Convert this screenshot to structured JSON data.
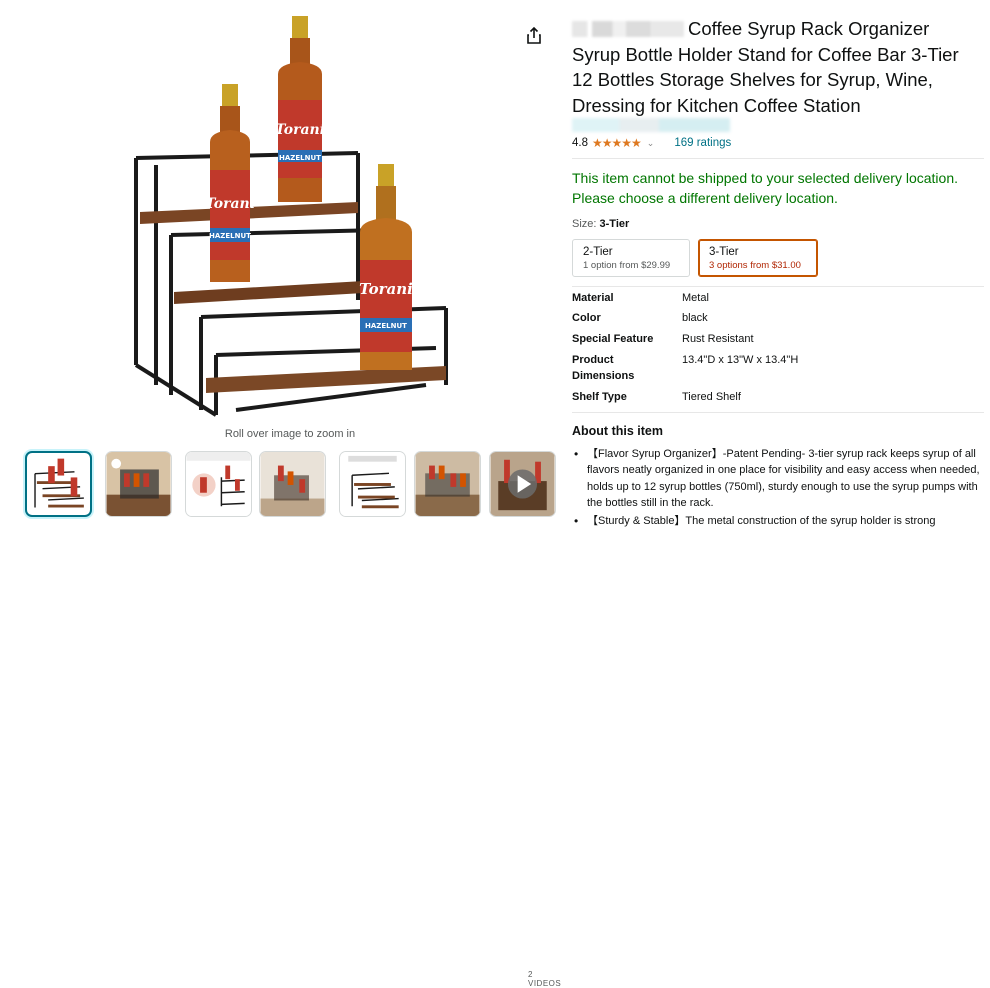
{
  "gallery": {
    "zoom_hint": "Roll over image to zoom in",
    "videos_label": "2 VIDEOS",
    "share_icon": "share-icon",
    "thumbnails": [
      {
        "name": "thumb-main-rack",
        "active": true
      },
      {
        "name": "thumb-kitchen-scene",
        "active": false
      },
      {
        "name": "thumb-install-guide",
        "active": false
      },
      {
        "name": "thumb-counter-scene",
        "active": false
      },
      {
        "name": "thumb-product-dimension",
        "active": false
      },
      {
        "name": "thumb-shelf-scene",
        "active": false
      },
      {
        "name": "thumb-video",
        "active": false
      }
    ],
    "bottle_label": "Torani",
    "bottle_flavor": "HAZELNUT"
  },
  "product": {
    "title": "Coffee Syrup Rack Organizer Syrup Bottle Holder Stand for Coffee Bar 3-Tier 12 Bottles Storage Shelves for Syrup, Wine, Dressing for Kitchen Coffee Station",
    "rating": "4.8",
    "stars": "★★★★★",
    "rating_count": "169 ratings",
    "shipping_message": "This item cannot be shipped to your selected delivery location. Please choose a different delivery location.",
    "size_label": "Size:",
    "size_selected": "3-Tier",
    "options": [
      {
        "name": "2-Tier",
        "price": "1 option from $29.99",
        "selected": false
      },
      {
        "name": "3-Tier",
        "price": "3 options from $31.00",
        "selected": true
      }
    ],
    "specs": [
      {
        "key": "Material",
        "value": "Metal"
      },
      {
        "key": "Color",
        "value": "black"
      },
      {
        "key": "Special Feature",
        "value": "Rust Resistant"
      },
      {
        "key": "Product Dimensions",
        "value": "13.4\"D x 13\"W x 13.4\"H"
      },
      {
        "key": "Shelf Type",
        "value": "Tiered Shelf"
      }
    ],
    "about_heading": "About this item",
    "bullets": [
      "【Flavor Syrup Organizer】-Patent Pending- 3-tier syrup rack keeps syrup of all flavors neatly organized in one place for visibility and easy access when needed, holds up to 12 syrup bottles (750ml), sturdy enough to use the syrup pumps with the bottles still in the rack.",
      "【Sturdy & Stable】The metal construction of the syrup holder is strong"
    ]
  },
  "colors": {
    "link": "#007185",
    "star": "#de7921",
    "ship_green": "#007600",
    "price_red": "#b12704",
    "selected_border": "#c45500"
  }
}
